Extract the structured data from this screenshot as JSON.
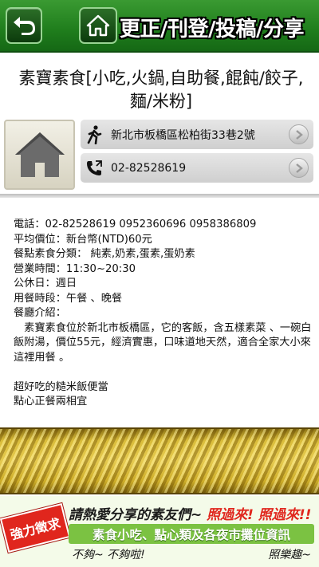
{
  "header": {
    "title": "更正/刊登/投稿/分享",
    "back_icon": "back-arrow-icon",
    "home_icon": "home-icon"
  },
  "page": {
    "title": "素寶素食[小吃,火鍋,自助餐,餛飩/餃子,麵/米粉]"
  },
  "info": {
    "address": "新北市板橋區松柏街33巷2號",
    "phone": "02-82528619"
  },
  "details": {
    "phone_line": "電話：02-82528619 0952360696 0958386809",
    "price_line": "平均價位：新台幣(NTD)60元",
    "category_line": "餐點素食分類： 純素,奶素,蛋素,蛋奶素",
    "hours_line": "營業時間：11:30~20:30",
    "holiday_line": "公休日：週日",
    "meal_line": "用餐時段：午餐 、晚餐",
    "intro_label": "餐廳介紹：",
    "intro_text": "　素寶素食位於新北市板橋區，它的客飯，含五樣素菜 、一碗白飯附湯，價位55元，經濟實惠，口味道地天然，適合全家大小來這裡用餐 。",
    "note1": "超好吃的糙米飯便當",
    "note2": "點心正餐兩相宜"
  },
  "ad": {
    "stamp": "強力徵求",
    "line1_prefix": "請熱愛分享的素友們~",
    "line1_red": " 照過來! 照過來!!",
    "line2": "素食小吃、點心類及各夜市攤位資訊",
    "line3_a": "不夠~ 不夠啦!",
    "line3_b": "照樂趣~"
  },
  "colors": {
    "header_green": "#1f7d1c",
    "ad_green": "#7bc242",
    "ad_red": "#e0261d"
  }
}
